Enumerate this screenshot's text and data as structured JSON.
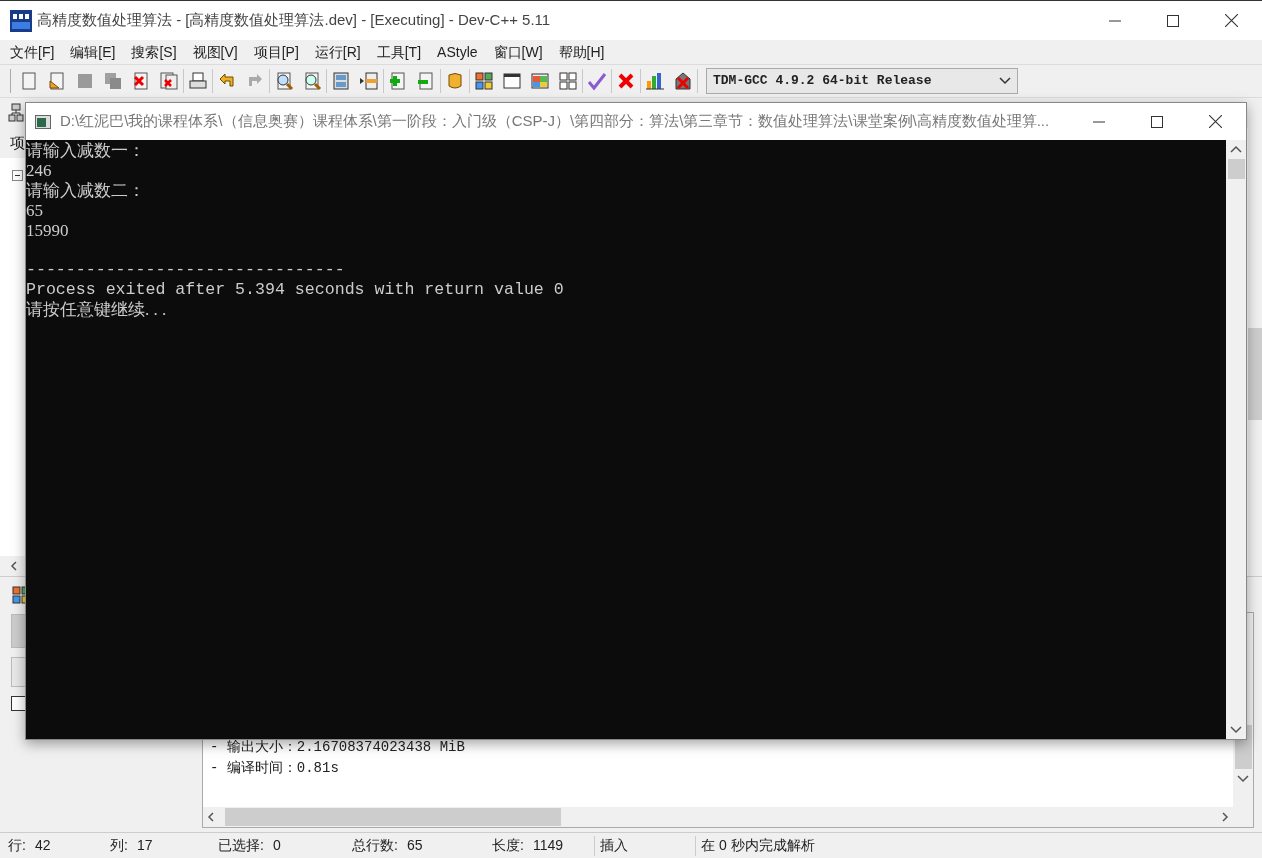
{
  "window": {
    "title": "高精度数值处理算法 - [高精度数值处理算法.dev] - [Executing] - Dev-C++ 5.11"
  },
  "menu": [
    "文件[F]",
    "编辑[E]",
    "搜索[S]",
    "视图[V]",
    "项目[P]",
    "运行[R]",
    "工具[T]",
    "AStyle",
    "窗口[W]",
    "帮助[H]"
  ],
  "compiler_select": {
    "value": "TDM-GCC 4.9.2 64-bit Release"
  },
  "project_panel": {
    "tab_label": "项",
    "tree_expanded": true
  },
  "compile_log": {
    "lines": [
      "- 输出大小：2.16708374023438 MiB",
      "- 编译时间：0.81s"
    ],
    "checkbox_checked": false
  },
  "status_bar": {
    "fields": [
      {
        "label": "行:",
        "value": "42"
      },
      {
        "label": "列:",
        "value": "17"
      },
      {
        "label": "已选择:",
        "value": "0"
      },
      {
        "label": "总行数:",
        "value": "65"
      },
      {
        "label": "长度:",
        "value": "1149"
      }
    ],
    "mode": "插入",
    "message": "在 0 秒内完成解析"
  },
  "console": {
    "title": "D:\\红泥巴\\我的课程体系\\（信息奥赛）课程体系\\第一阶段：入门级（CSP-J）\\第四部分：算法\\第三章节：数值处理算法\\课堂案例\\高精度数值处理算...",
    "lines": [
      {
        "kind": "plain",
        "text": "请输入减数一："
      },
      {
        "kind": "plain",
        "text": "246"
      },
      {
        "kind": "plain",
        "text": "请输入减数二："
      },
      {
        "kind": "plain",
        "text": "65"
      },
      {
        "kind": "plain",
        "text": "15990"
      },
      {
        "kind": "rule",
        "text": "--------------------------------"
      },
      {
        "kind": "mono",
        "text": "Process exited after 5.394 seconds with return value 0"
      },
      {
        "kind": "plain",
        "text": "请按任意键继续. . ."
      }
    ]
  }
}
